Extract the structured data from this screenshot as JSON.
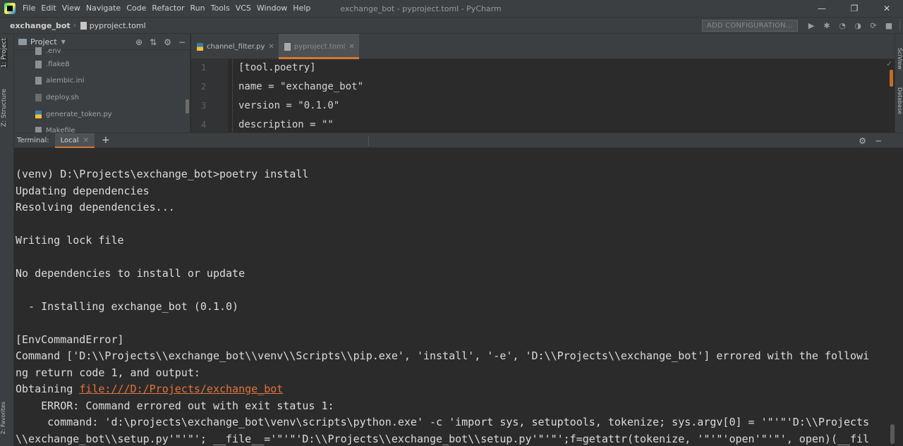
{
  "window": {
    "title": "exchange_bot - pyproject.toml - PyCharm",
    "menu": [
      "File",
      "Edit",
      "View",
      "Navigate",
      "Code",
      "Refactor",
      "Run",
      "Tools",
      "VCS",
      "Window",
      "Help"
    ],
    "controls": {
      "minimize": "—",
      "maximize": "❐",
      "close": "✕"
    }
  },
  "navbar": {
    "project": "exchange_bot",
    "file": "pyproject.toml",
    "add_config": "ADD CONFIGURATION..."
  },
  "left_strip": {
    "project_tab": "1: Project",
    "structure_tab": "Z: Structure",
    "favorites_tab": "2: Favorites"
  },
  "right_strip": {
    "sciview_tab": "SciView",
    "database_tab": "Database"
  },
  "project_panel": {
    "title": "Project",
    "items": [
      ".env",
      ".flake8",
      "alembic.ini",
      "deploy.sh",
      "generate_token.py",
      "Makefile"
    ]
  },
  "editor": {
    "tabs": [
      {
        "label": "channel_filter.py",
        "active": false
      },
      {
        "label": "pyproject.toml",
        "active": true
      }
    ],
    "line_numbers": [
      "1",
      "2",
      "3",
      "4"
    ],
    "lines": [
      "[tool.poetry]",
      "name = \"exchange_bot\"",
      "version = \"0.1.0\"",
      "description = \"\""
    ]
  },
  "terminal": {
    "label": "Terminal:",
    "tab": "Local",
    "lines": [
      "(venv) D:\\Projects\\exchange_bot>poetry install",
      "Updating dependencies",
      "Resolving dependencies...",
      "",
      "Writing lock file",
      "",
      "No dependencies to install or update",
      "",
      "  - Installing exchange_bot (0.1.0)",
      "",
      "[EnvCommandError]",
      "Command ['D:\\\\Projects\\\\exchange_bot\\\\venv\\\\Scripts\\\\pip.exe', 'install', '-e', 'D:\\\\Projects\\\\exchange_bot'] errored with the followi",
      "ng return code 1, and output:",
      "Obtaining ",
      "    ERROR: Command errored out with exit status 1:",
      "     command: 'd:\\projects\\exchange_bot\\venv\\scripts\\python.exe' -c 'import sys, setuptools, tokenize; sys.argv[0] = '\"'\"'D:\\\\Projects",
      "\\\\exchange_bot\\\\setup.py'\"'\"'; __file__='\"'\"'D:\\\\Projects\\\\exchange_bot\\\\setup.py'\"'\"';f=getattr(tokenize, '\"'\"'open'\"'\"', open)(__fil"
    ],
    "link": "file:///D:/Projects/exchange_bot"
  }
}
